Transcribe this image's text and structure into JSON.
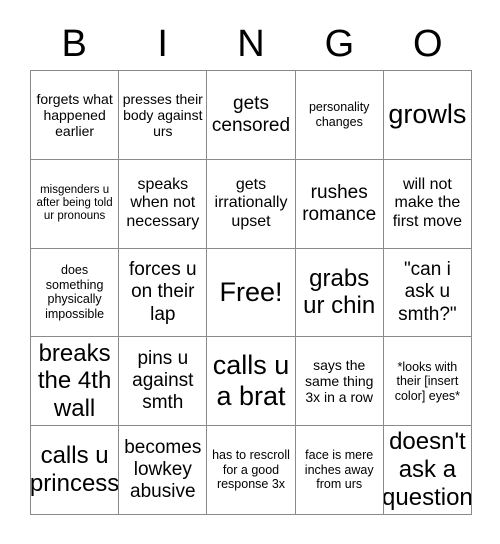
{
  "card": {
    "title": "BINGO",
    "header_letters": [
      "B",
      "I",
      "N",
      "G",
      "O"
    ],
    "free_space_label": "Free!",
    "colors": {
      "background": "#ffffff",
      "text": "#000000",
      "grid_line": "#8a8a8a"
    },
    "grid": {
      "rows": 5,
      "columns": 5,
      "cells": [
        {
          "text": "forgets what happened earlier",
          "size": "sm"
        },
        {
          "text": "presses their body against urs",
          "size": "sm"
        },
        {
          "text": "gets censored",
          "size": "lg"
        },
        {
          "text": "personality changes",
          "size": "xs"
        },
        {
          "text": "growls",
          "size": "xxl"
        },
        {
          "text": "misgenders u after being told ur pronouns",
          "size": "xxs"
        },
        {
          "text": "speaks when not necessary",
          "size": "md"
        },
        {
          "text": "gets irrationally upset",
          "size": "md"
        },
        {
          "text": "rushes romance",
          "size": "lg"
        },
        {
          "text": "will not make the first move",
          "size": "md"
        },
        {
          "text": "does something physically impossible",
          "size": "xs"
        },
        {
          "text": "forces u on their lap",
          "size": "lg"
        },
        {
          "text": "Free!",
          "size": "xxl"
        },
        {
          "text": "grabs ur chin",
          "size": "xl"
        },
        {
          "text": "\"can i ask u smth?\"",
          "size": "lg"
        },
        {
          "text": "breaks the 4th wall",
          "size": "xl"
        },
        {
          "text": "pins u against smth",
          "size": "lg"
        },
        {
          "text": "calls u a brat",
          "size": "xxl"
        },
        {
          "text": "says the same thing 3x in a row",
          "size": "sm"
        },
        {
          "text": "*looks with their [insert color] eyes*",
          "size": "xs"
        },
        {
          "text": "calls u princess",
          "size": "xl"
        },
        {
          "text": "becomes lowkey abusive",
          "size": "lg"
        },
        {
          "text": "has to rescroll for a good response 3x",
          "size": "xs"
        },
        {
          "text": "face is mere inches away from urs",
          "size": "xs"
        },
        {
          "text": "doesn't ask a question",
          "size": "xl"
        }
      ]
    }
  }
}
